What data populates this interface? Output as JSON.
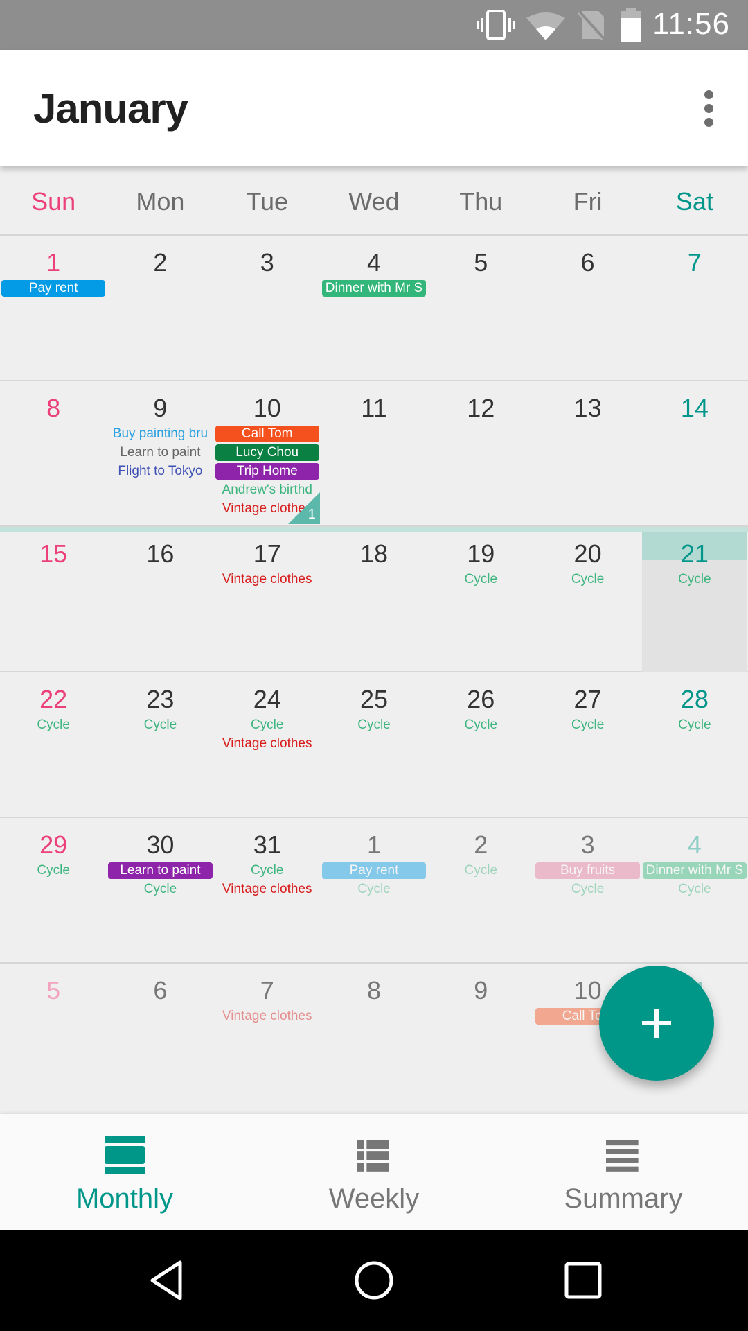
{
  "status_bar": {
    "time": "11:56",
    "icons": [
      "vibrate-icon",
      "wifi-icon",
      "no-sim-icon",
      "battery-icon"
    ]
  },
  "toolbar": {
    "title": "January",
    "menu_icon": "more-vert-icon"
  },
  "weekdays": [
    "Sun",
    "Mon",
    "Tue",
    "Wed",
    "Thu",
    "Fri",
    "Sat"
  ],
  "colors": {
    "accent": "#009688",
    "sunday": "#ec407a",
    "saturday": "#00968a",
    "cycle": "#3db57f",
    "vintage": "#d81b1b"
  },
  "weeks": [
    {
      "days": [
        {
          "num": "1",
          "events": [
            {
              "title": "Pay rent",
              "style": "chip",
              "color": "#039be5"
            }
          ]
        },
        {
          "num": "2",
          "events": []
        },
        {
          "num": "3",
          "events": []
        },
        {
          "num": "4",
          "events": [
            {
              "title": "Dinner with Mr S",
              "style": "chip",
              "color": "#33b679"
            }
          ]
        },
        {
          "num": "5",
          "events": []
        },
        {
          "num": "6",
          "events": []
        },
        {
          "num": "7",
          "events": []
        }
      ]
    },
    {
      "days": [
        {
          "num": "8",
          "events": []
        },
        {
          "num": "9",
          "events": [
            {
              "title": "Buy painting bru",
              "style": "text",
              "color": "#29a0e0"
            },
            {
              "title": "Learn to paint",
              "style": "text",
              "color": "#666666"
            },
            {
              "title": "Flight to Tokyo",
              "style": "text",
              "color": "#3f51b5"
            }
          ]
        },
        {
          "num": "10",
          "more": "1",
          "events": [
            {
              "title": "Call Tom",
              "style": "chip",
              "color": "#f4511e"
            },
            {
              "title": "Lucy Chou",
              "style": "chip",
              "color": "#0b8043"
            },
            {
              "title": "Trip Home",
              "style": "chip",
              "color": "#8e24aa"
            },
            {
              "title": "Andrew's birthd",
              "style": "text",
              "color": "#3db57f"
            },
            {
              "title": "Vintage clothes",
              "style": "text",
              "color": "#d81b1b"
            }
          ]
        },
        {
          "num": "11",
          "events": []
        },
        {
          "num": "12",
          "events": []
        },
        {
          "num": "13",
          "events": []
        },
        {
          "num": "14",
          "events": []
        }
      ]
    },
    {
      "days": [
        {
          "num": "15",
          "events": []
        },
        {
          "num": "16",
          "events": []
        },
        {
          "num": "17",
          "events": [
            {
              "title": "Vintage clothes",
              "style": "text",
              "color": "#d81b1b"
            }
          ]
        },
        {
          "num": "18",
          "events": []
        },
        {
          "num": "19",
          "events": [
            {
              "title": "Cycle",
              "style": "text",
              "color": "#3db57f"
            }
          ]
        },
        {
          "num": "20",
          "events": [
            {
              "title": "Cycle",
              "style": "text",
              "color": "#3db57f"
            }
          ]
        },
        {
          "num": "21",
          "today": true,
          "events": [
            {
              "title": "Cycle",
              "style": "text",
              "color": "#3db57f"
            }
          ]
        }
      ]
    },
    {
      "days": [
        {
          "num": "22",
          "events": [
            {
              "title": "Cycle",
              "style": "text",
              "color": "#3db57f"
            }
          ]
        },
        {
          "num": "23",
          "events": [
            {
              "title": "Cycle",
              "style": "text",
              "color": "#3db57f"
            }
          ]
        },
        {
          "num": "24",
          "events": [
            {
              "title": "Cycle",
              "style": "text",
              "color": "#3db57f"
            },
            {
              "title": "Vintage clothes",
              "style": "text",
              "color": "#d81b1b"
            }
          ]
        },
        {
          "num": "25",
          "events": [
            {
              "title": "Cycle",
              "style": "text",
              "color": "#3db57f"
            }
          ]
        },
        {
          "num": "26",
          "events": [
            {
              "title": "Cycle",
              "style": "text",
              "color": "#3db57f"
            }
          ]
        },
        {
          "num": "27",
          "events": [
            {
              "title": "Cycle",
              "style": "text",
              "color": "#3db57f"
            }
          ]
        },
        {
          "num": "28",
          "events": [
            {
              "title": "Cycle",
              "style": "text",
              "color": "#3db57f"
            }
          ]
        }
      ]
    },
    {
      "days": [
        {
          "num": "29",
          "events": [
            {
              "title": "Cycle",
              "style": "text",
              "color": "#3db57f"
            }
          ]
        },
        {
          "num": "30",
          "events": [
            {
              "title": "Learn to paint",
              "style": "chip",
              "color": "#8e24aa"
            },
            {
              "title": "Cycle",
              "style": "text",
              "color": "#3db57f"
            }
          ]
        },
        {
          "num": "31",
          "events": [
            {
              "title": "Cycle",
              "style": "text",
              "color": "#3db57f"
            },
            {
              "title": "Vintage clothes",
              "style": "text",
              "color": "#d81b1b"
            }
          ]
        },
        {
          "num": "1",
          "other_month": true,
          "events": [
            {
              "title": "Pay rent",
              "style": "chip",
              "color": "#039be5"
            },
            {
              "title": "Cycle",
              "style": "text",
              "color": "#3db57f"
            }
          ]
        },
        {
          "num": "2",
          "other_month": true,
          "events": [
            {
              "title": "Cycle",
              "style": "text",
              "color": "#3db57f"
            }
          ]
        },
        {
          "num": "3",
          "other_month": true,
          "events": [
            {
              "title": "Buy fruits",
              "style": "chip",
              "color": "#e67c9f"
            },
            {
              "title": "Cycle",
              "style": "text",
              "color": "#3db57f"
            }
          ]
        },
        {
          "num": "4",
          "other_month": true,
          "events": [
            {
              "title": "Dinner with Mr S",
              "style": "chip",
              "color": "#33b679"
            },
            {
              "title": "Cycle",
              "style": "text",
              "color": "#3db57f"
            }
          ]
        }
      ]
    },
    {
      "days": [
        {
          "num": "5",
          "other_month": true,
          "events": []
        },
        {
          "num": "6",
          "other_month": true,
          "events": []
        },
        {
          "num": "7",
          "other_month": true,
          "events": [
            {
              "title": "Vintage clothes",
              "style": "text",
              "color": "#d81b1b"
            }
          ]
        },
        {
          "num": "8",
          "other_month": true,
          "events": []
        },
        {
          "num": "9",
          "other_month": true,
          "events": []
        },
        {
          "num": "10",
          "other_month": true,
          "events": [
            {
              "title": "Call Tom",
              "style": "chip",
              "color": "#f4511e"
            }
          ]
        },
        {
          "num": "11",
          "other_month": true,
          "events": []
        }
      ]
    }
  ],
  "fab": {
    "icon": "plus-icon",
    "label": "Add event"
  },
  "bottom_nav": {
    "tabs": [
      {
        "label": "Monthly",
        "icon": "monthly-view-icon",
        "active": true
      },
      {
        "label": "Weekly",
        "icon": "weekly-view-icon",
        "active": false
      },
      {
        "label": "Summary",
        "icon": "summary-view-icon",
        "active": false
      }
    ]
  },
  "system_nav": [
    "back-icon",
    "home-icon",
    "recents-icon"
  ]
}
